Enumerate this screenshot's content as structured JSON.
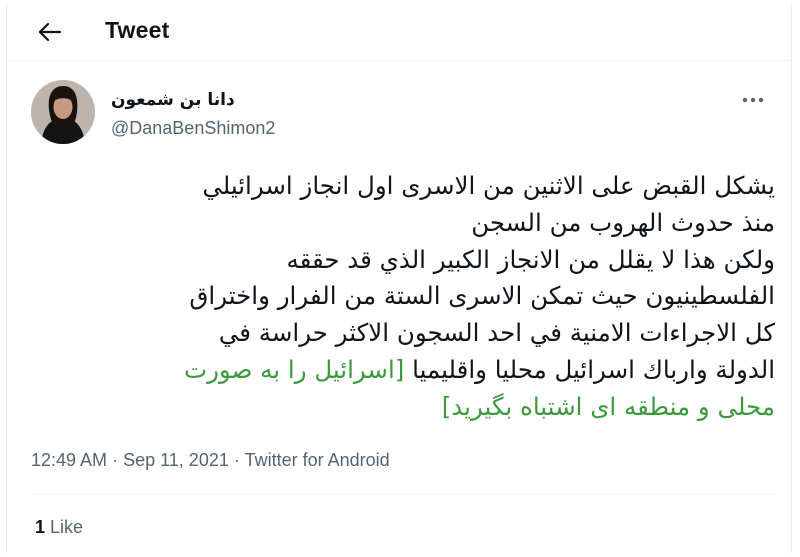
{
  "header": {
    "title": "Tweet",
    "back_icon": "arrow-left-icon"
  },
  "author": {
    "display_name": "دانا بن شمعون",
    "handle": "@DanaBenShimon2",
    "more_icon": "more-horizontal-icon"
  },
  "tweet": {
    "lines": [
      "يشكل القبض على الاثنين من الاسرى اول انجاز اسرائيلي",
      "منذ حدوث الهروب من السجن",
      "ولكن هذا لا يقلل من الانجاز الكبير الذي قد حققه",
      "الفلسطينيون حيث تمكن الاسرى الستة من الفرار واختراق",
      "كل الاجراءات الامنية في احد السجون الاكثر حراسة في",
      "الدولة وارباك اسرائيل محليا واقليميا"
    ],
    "translation": [
      "[اسرائیل را به صورت",
      "محلی و منطقه ای اشتباه بگیرید]"
    ]
  },
  "meta": {
    "time": "12:49 AM",
    "date": "Sep 11, 2021",
    "source": "Twitter for Android",
    "separator": "·"
  },
  "stats": {
    "likes_count": "1",
    "likes_label": "Like"
  },
  "colors": {
    "text": "#0f1419",
    "secondary": "#536471",
    "translation_green": "#3c9a3c"
  }
}
